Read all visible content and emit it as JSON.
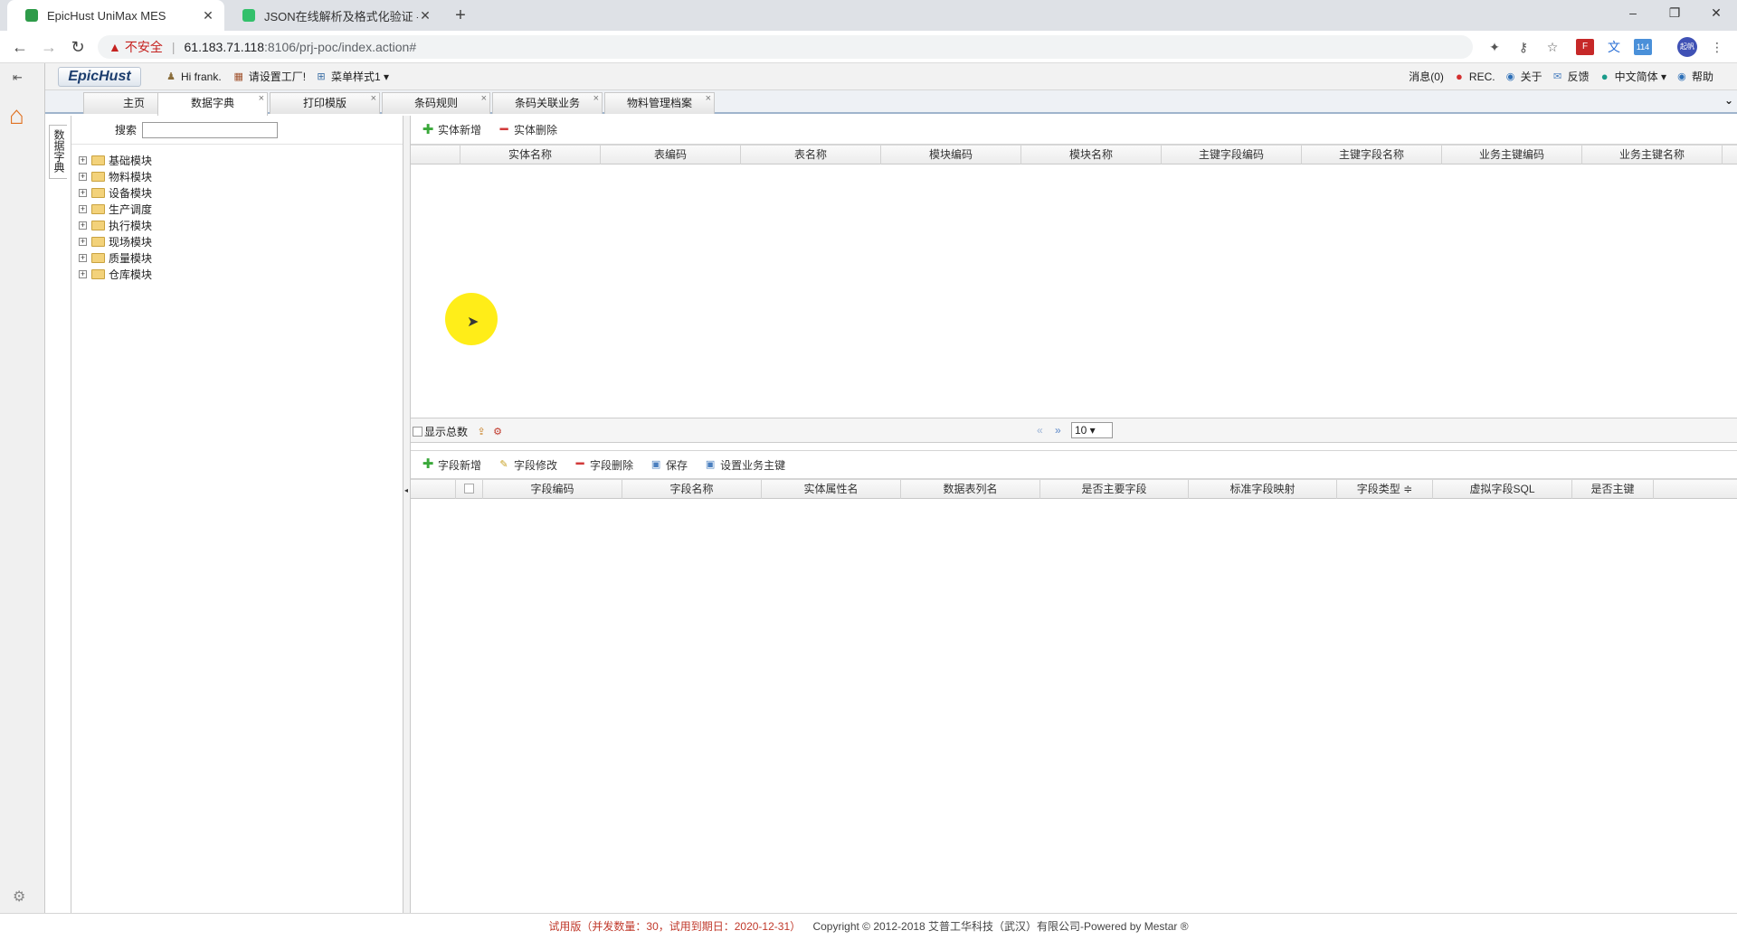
{
  "browser": {
    "tabs": [
      {
        "title": "EpicHust UniMax MES",
        "close": "✕"
      },
      {
        "title": "JSON在线解析及格式化验证 - JS",
        "close": "✕"
      }
    ],
    "new_tab": "+",
    "url": {
      "warning": "不安全",
      "host": "61.183.71.118",
      "path": ":8106/prj-poc/index.action#"
    },
    "window": {
      "minimize": "–",
      "restore": "❐",
      "close": "✕"
    },
    "ext_badge": "114",
    "profile": "起帆"
  },
  "app": {
    "logo": "EpicHust",
    "greeting": "Hi frank.",
    "factory": "请设置工厂!",
    "menu_style": "菜单样式1 ▾",
    "right_links": {
      "messages": "消息(0)",
      "rec": "REC.",
      "about": "关于",
      "feedback": "反馈",
      "language": "中文简体 ▾",
      "help": "帮助"
    },
    "tabs": [
      {
        "label": "主页"
      },
      {
        "label": "数据字典"
      },
      {
        "label": "打印模版"
      },
      {
        "label": "条码规则"
      },
      {
        "label": "条码关联业务"
      },
      {
        "label": "物料管理档案"
      }
    ],
    "tab_close": "×",
    "left_panel": {
      "vertical_tab": "数据字典",
      "search_label": "搜索",
      "search_value": "",
      "tree": [
        {
          "label": "基础模块"
        },
        {
          "label": "物料模块"
        },
        {
          "label": "设备模块"
        },
        {
          "label": "生产调度"
        },
        {
          "label": "执行模块"
        },
        {
          "label": "现场模块"
        },
        {
          "label": "质量模块"
        },
        {
          "label": "仓库模块"
        }
      ]
    },
    "entity_toolbar": {
      "add": "实体新增",
      "delete": "实体删除"
    },
    "entity_columns": [
      "实体名称",
      "表编码",
      "表名称",
      "模块编码",
      "模块名称",
      "主键字段编码",
      "主键字段名称",
      "业务主键编码",
      "业务主键名称"
    ],
    "pager": {
      "show_total": "显示总数",
      "page_size": "10 ▾"
    },
    "field_toolbar": {
      "add": "字段新增",
      "edit": "字段修改",
      "delete": "字段删除",
      "save": "保存",
      "set_key": "设置业务主键"
    },
    "field_columns": [
      "字段编码",
      "字段名称",
      "实体属性名",
      "数据表列名",
      "是否主要字段",
      "标准字段映射",
      "字段类型 ≑",
      "虚拟字段SQL",
      "是否主键"
    ],
    "footer": {
      "trial": "试用版（并发数量：30，试用到期日：2020-12-31）",
      "copyright": "Copyright © 2012-2018 艾普工华科技（武汉）有限公司-Powered by Mestar ®"
    }
  }
}
